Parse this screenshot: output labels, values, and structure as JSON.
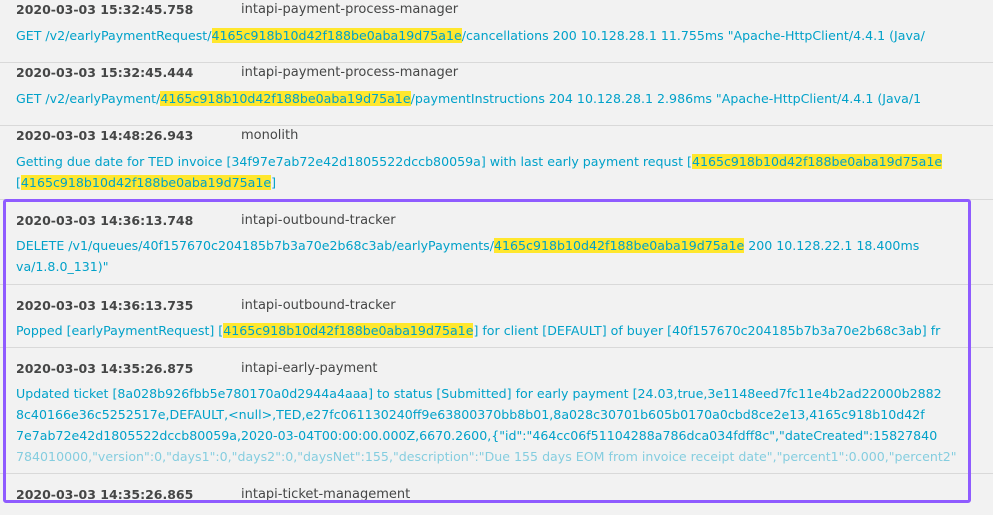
{
  "accent": {
    "link": "#00a1c9",
    "highlight": "#ffe72e",
    "selection_box": "#8f5bff"
  },
  "logs": [
    {
      "timestamp": "2020-03-03 15:32:45.758",
      "service": "intapi-payment-process-manager",
      "lines": [
        [
          {
            "t": "GET /v2/earlyPaymentRequest/"
          },
          {
            "t": "4165c918b10d42f188be0aba19d75a1e",
            "hl": true
          },
          {
            "t": "/cancellations 200 10.128.28.1 11.755ms \"Apache-HttpClient/4.4.1 (Java/"
          }
        ]
      ]
    },
    {
      "timestamp": "2020-03-03 15:32:45.444",
      "service": "intapi-payment-process-manager",
      "lines": [
        [
          {
            "t": "GET /v2/earlyPayment/"
          },
          {
            "t": "4165c918b10d42f188be0aba19d75a1e",
            "hl": true
          },
          {
            "t": "/paymentInstructions 204 10.128.28.1 2.986ms \"Apache-HttpClient/4.4.1 (Java/1"
          }
        ]
      ]
    },
    {
      "timestamp": "2020-03-03 14:48:26.943",
      "service": "monolith",
      "lines": [
        [
          {
            "t": "Getting due date for TED invoice [34f97e7ab72e42d1805522dccb80059a] with last early payment requst ["
          },
          {
            "t": "4165c918b10d42f188be0aba19d75a1e",
            "hl": true
          }
        ],
        [
          {
            "t": "["
          },
          {
            "t": "4165c918b10d42f188be0aba19d75a1e",
            "hl": true
          },
          {
            "t": "]"
          }
        ]
      ]
    },
    {
      "timestamp": "2020-03-03 14:36:13.748",
      "service": "intapi-outbound-tracker",
      "lines": [
        [
          {
            "t": "DELETE /v1/queues/40f157670c204185b7b3a70e2b68c3ab/earlyPayments/"
          },
          {
            "t": "4165c918b10d42f188be0aba19d75a1e",
            "hl": true
          },
          {
            "t": " 200 10.128.22.1 18.400ms"
          }
        ],
        [
          {
            "t": "va/1.8.0_131)\""
          }
        ]
      ]
    },
    {
      "timestamp": "2020-03-03 14:36:13.735",
      "service": "intapi-outbound-tracker",
      "lines": [
        [
          {
            "t": "Popped [earlyPaymentRequest] ["
          },
          {
            "t": "4165c918b10d42f188be0aba19d75a1e",
            "hl": true
          },
          {
            "t": "] for client [DEFAULT] of buyer [40f157670c204185b7b3a70e2b68c3ab] fr"
          }
        ]
      ]
    },
    {
      "timestamp": "2020-03-03 14:35:26.875",
      "service": "intapi-early-payment",
      "lines": [
        [
          {
            "t": "Updated ticket [8a028b926fbb5e780170a0d2944a4aaa] to status [Submitted] for early payment [24.03,true,3e1148eed7fc11e4b2ad22000b2882"
          }
        ],
        [
          {
            "t": "8c40166e36c5252517e,DEFAULT,<null>,TED,e27fc061130240ff9e63800370bb8b01,8a028c30701b605b0170a0cbd8ce2e13,4165c918b10d42f"
          }
        ],
        [
          {
            "t": "7e7ab72e42d1805522dccb80059a,2020-03-04T00:00:00.000Z,6670.2600,{\"id\":\"464cc06f51104288a786dca034fdff8c\",\"dateCreated\":15827840"
          }
        ],
        [
          {
            "t": "784010000,\"version\":0,\"days1\":0,\"days2\":0,\"daysNet\":155,\"description\":\"Due 155 days EOM from invoice receipt date\",\"percent1\":0.000,\"percent2\""
          }
        ]
      ]
    },
    {
      "timestamp": "2020-03-03 14:35:26.865",
      "service": "intapi-ticket-management",
      "lines": []
    }
  ]
}
